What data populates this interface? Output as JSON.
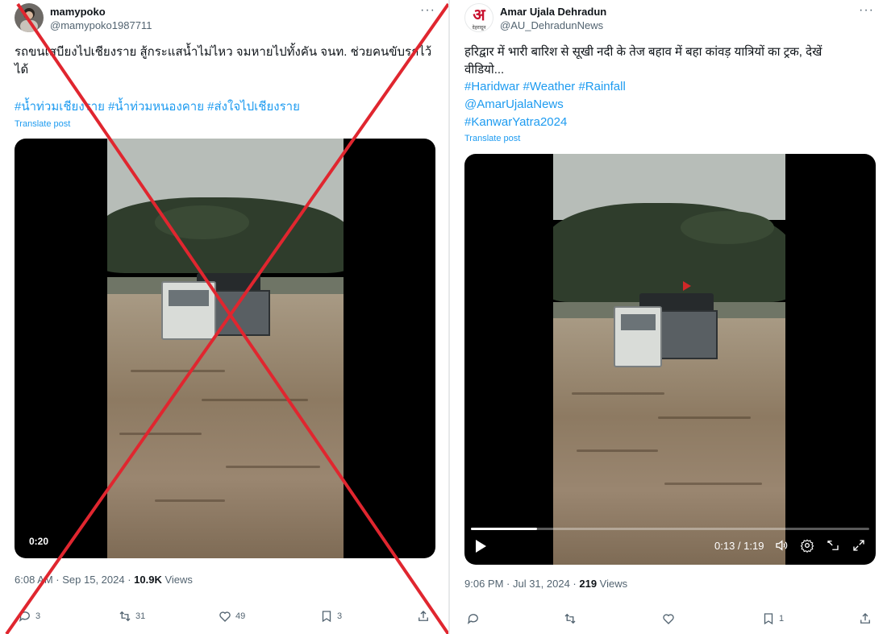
{
  "left_post": {
    "author_name": "mamypoko",
    "author_handle": "@mamypoko1987711",
    "more_icon": "more-icon",
    "text_line1": "รถขนเสบียงไปเชียงราย สู้กระแสน้ำไม่ไหว จมหายไปทั้งคัน จนท. ช่วยคนขับรถไว้",
    "text_line2": "ได้",
    "hashtags": "#น้ำท่วมเชียงราย #น้ำท่วมหนองคาย #ส่งใจไปเชียงราย",
    "translate": "Translate post",
    "video_duration": "0:20",
    "timestamp": "6:08 AM · Sep 15, 2024 · ",
    "views_count": "10.9K",
    "views_label": " Views",
    "replies": "3",
    "reposts": "31",
    "likes": "49",
    "bookmarks": "3",
    "overlay_color": "#e0262f"
  },
  "right_post": {
    "author_name": "Amar Ujala Dehradun",
    "author_handle": "@AU_DehradunNews",
    "logo_glyph": "अ",
    "logo_subtext": "देहरादून",
    "more_icon": "more-icon",
    "text_line1": "हरिद्वार में भारी बारिश से सूखी नदी के तेज बहाव में बहा कांवड़ यात्रियों का ट्रक, देखें",
    "text_line2": "वीडियो...",
    "hashtags_line1": "#Haridwar #Weather #Rainfall",
    "mention": "@AmarUjalaNews",
    "hashtag2": "#KanwarYatra2024",
    "translate": "Translate post",
    "video_time": "0:13 / 1:19",
    "video_progress": 0.167,
    "timestamp": "9:06 PM · Jul 31, 2024 · ",
    "views_count": "219",
    "views_label": " Views",
    "bookmarks": "1",
    "brand_color": "#c8102e"
  }
}
